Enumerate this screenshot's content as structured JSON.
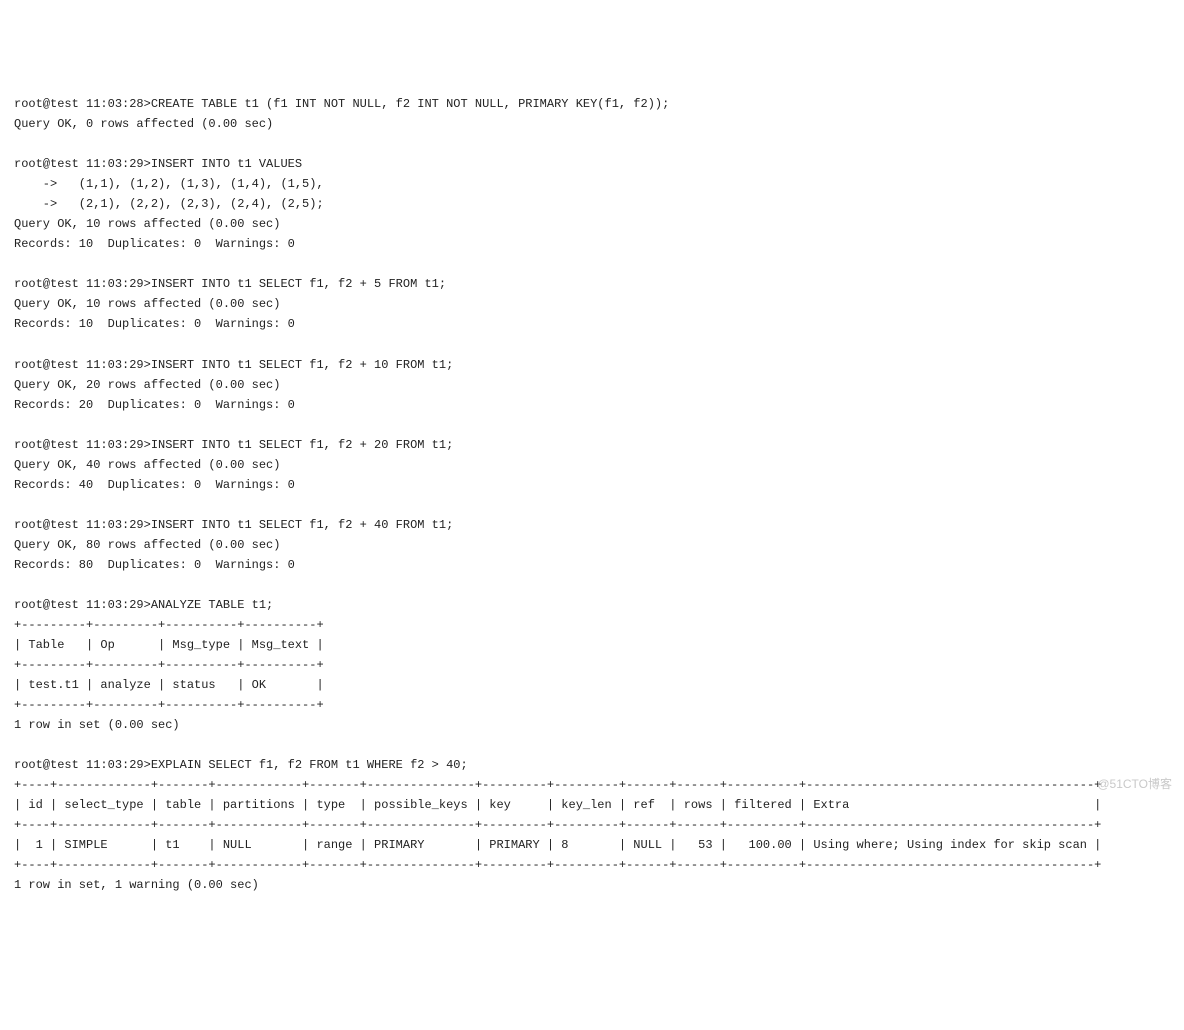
{
  "lines": [
    "root@test 11:03:28>CREATE TABLE t1 (f1 INT NOT NULL, f2 INT NOT NULL, PRIMARY KEY(f1, f2));",
    "Query OK, 0 rows affected (0.00 sec)",
    "",
    "root@test 11:03:29>INSERT INTO t1 VALUES",
    "    ->   (1,1), (1,2), (1,3), (1,4), (1,5),",
    "    ->   (2,1), (2,2), (2,3), (2,4), (2,5);",
    "Query OK, 10 rows affected (0.00 sec)",
    "Records: 10  Duplicates: 0  Warnings: 0",
    "",
    "root@test 11:03:29>INSERT INTO t1 SELECT f1, f2 + 5 FROM t1;",
    "Query OK, 10 rows affected (0.00 sec)",
    "Records: 10  Duplicates: 0  Warnings: 0",
    "",
    "root@test 11:03:29>INSERT INTO t1 SELECT f1, f2 + 10 FROM t1;",
    "Query OK, 20 rows affected (0.00 sec)",
    "Records: 20  Duplicates: 0  Warnings: 0",
    "",
    "root@test 11:03:29>INSERT INTO t1 SELECT f1, f2 + 20 FROM t1;",
    "Query OK, 40 rows affected (0.00 sec)",
    "Records: 40  Duplicates: 0  Warnings: 0",
    "",
    "root@test 11:03:29>INSERT INTO t1 SELECT f1, f2 + 40 FROM t1;",
    "Query OK, 80 rows affected (0.00 sec)",
    "Records: 80  Duplicates: 0  Warnings: 0",
    "",
    "root@test 11:03:29>ANALYZE TABLE t1;",
    "+---------+---------+----------+----------+",
    "| Table   | Op      | Msg_type | Msg_text |",
    "+---------+---------+----------+----------+",
    "| test.t1 | analyze | status   | OK       |",
    "+---------+---------+----------+----------+",
    "1 row in set (0.00 sec)",
    "",
    "root@test 11:03:29>EXPLAIN SELECT f1, f2 FROM t1 WHERE f2 > 40;",
    "+----+-------------+-------+------------+-------+---------------+---------+---------+------+------+----------+----------------------------------------+",
    "| id | select_type | table | partitions | type  | possible_keys | key     | key_len | ref  | rows | filtered | Extra                                  |",
    "+----+-------------+-------+------------+-------+---------------+---------+---------+------+------+----------+----------------------------------------+",
    "|  1 | SIMPLE      | t1    | NULL       | range | PRIMARY       | PRIMARY | 8       | NULL |   53 |   100.00 | Using where; Using index for skip scan |",
    "+----+-------------+-------+------------+-------+---------------+---------+---------+------+------+----------+----------------------------------------+",
    "1 row in set, 1 warning (0.00 sec)"
  ],
  "watermark": "@51CTO博客"
}
